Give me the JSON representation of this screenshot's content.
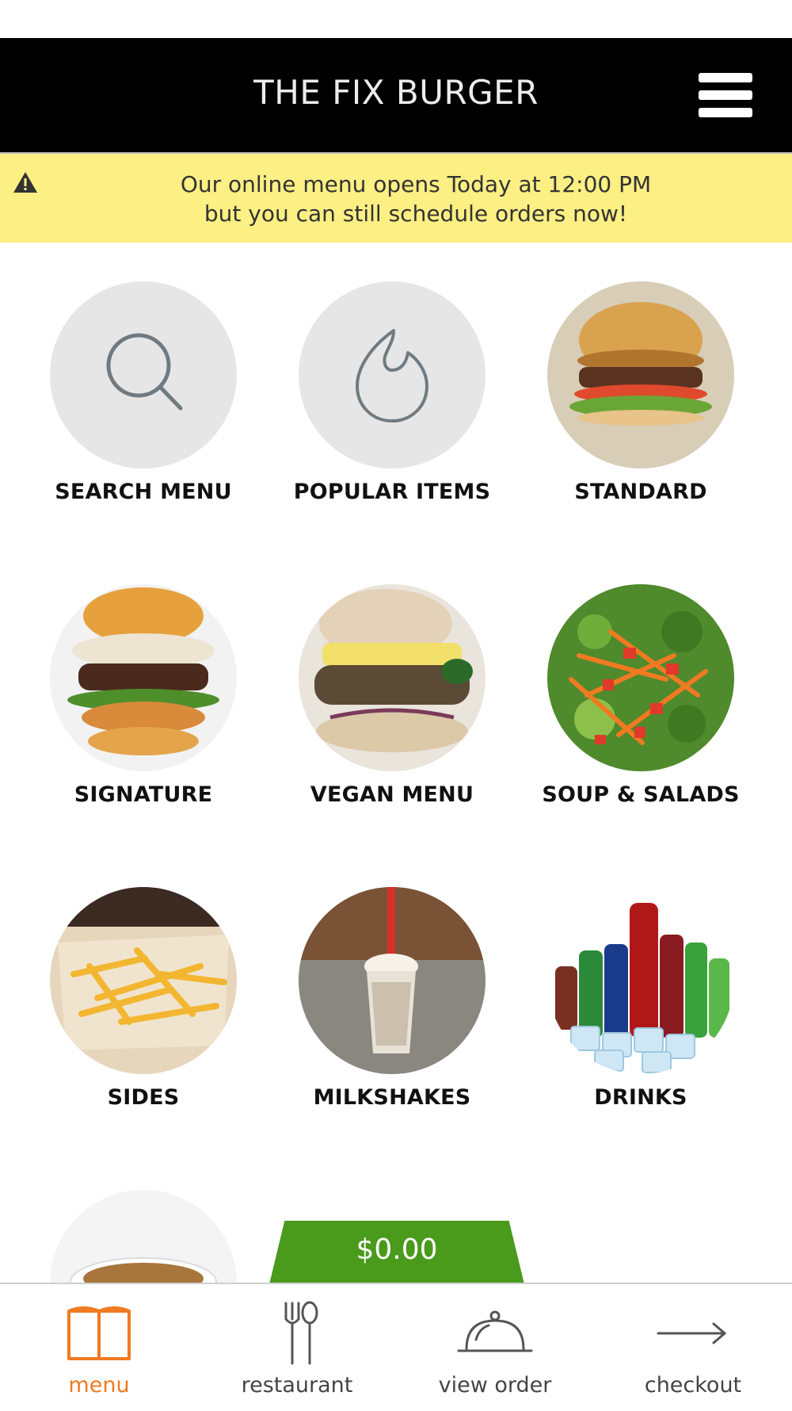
{
  "app": {
    "title": "THE FIX BURGER"
  },
  "header": {
    "menu_icon": "hamburger-menu-icon"
  },
  "notice": {
    "icon": "warning-icon",
    "line1": "Our online menu opens Today at 12:00 PM",
    "line2": "but you can still schedule orders now!"
  },
  "categories": [
    {
      "label": "SEARCH MENU",
      "icon": "search-icon"
    },
    {
      "label": "POPULAR ITEMS",
      "icon": "flame-icon"
    },
    {
      "label": "STANDARD",
      "image": "standard-burger-photo"
    },
    {
      "label": "SIGNATURE",
      "image": "signature-burger-photo"
    },
    {
      "label": "VEGAN MENU",
      "image": "vegan-burger-photo"
    },
    {
      "label": "SOUP & SALADS",
      "image": "salad-photo"
    },
    {
      "label": "SIDES",
      "image": "fries-photo"
    },
    {
      "label": "MILKSHAKES",
      "image": "milkshake-photo"
    },
    {
      "label": "DRINKS",
      "image": "soda-bottles-photo"
    },
    {
      "label": "",
      "image": "soup-photo"
    }
  ],
  "order": {
    "total": "$0.00"
  },
  "bottom_nav": [
    {
      "label": "menu",
      "icon": "book-icon",
      "active": true
    },
    {
      "label": "restaurant",
      "icon": "fork-spoon-icon",
      "active": false
    },
    {
      "label": "view order",
      "icon": "cloche-icon",
      "active": false
    },
    {
      "label": "checkout",
      "icon": "arrow-right-icon",
      "active": false
    }
  ],
  "colors": {
    "header_bg": "#000000",
    "notice_bg": "#fcef83",
    "total_bg": "#4a9a1c",
    "active_nav": "#f07a22"
  }
}
